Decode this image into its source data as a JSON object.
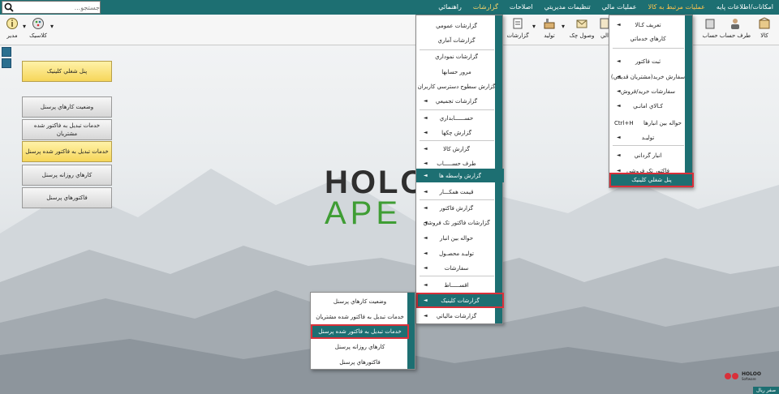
{
  "menubar": {
    "items": [
      "امکانات/اطلاعات پايه",
      "عمليات مرتبط به کالا",
      "عمليات مالي",
      "تنظيمات مديريتي",
      "اصلاحات",
      "گزارشات",
      "راهنمائي"
    ],
    "search_placeholder": "جستجو..."
  },
  "toolbar": {
    "right": [
      "کالا",
      "طرف حساب",
      "حساب",
      "الي"
    ],
    "middle": [
      "وصول چک",
      "توليد",
      "گزارشات"
    ],
    "left": [
      "مدير",
      "کلاسيک"
    ]
  },
  "left_panel": {
    "top_button": "پنل شغلي کلينيک",
    "buttons": [
      "وضعيت کارهاي پرسنل",
      "خدمات تبديل به فاکتور شده مشتريان",
      "خدمات تبديل به فاکتور شده پرسنل",
      "کارهاي روزانه پرسنل",
      "فاکتورهاي پرسنل"
    ]
  },
  "logo": {
    "line1": "HOLO",
    "line2": "APE"
  },
  "kala_menu": {
    "items": [
      "تعريف کـالا",
      "کارهاي خدماتي",
      "ثبت فاکتور",
      "سفارش خريد(مشتريان قديمي)",
      "سفارشات خريد/فروش",
      "کـالاي امانـي",
      "حواله بين انبارها",
      "توليـد",
      "انبار گرداني",
      "فاکتور تک فروشي",
      "پنل شغلي کلينيک"
    ],
    "shortcut": "Ctrl+H"
  },
  "reports_menu": {
    "items": [
      "گزارشات عمومي",
      "گزارشات آماري",
      "گزارشات نموداري",
      "مرور حسابها",
      "گزارش سطوح دسترسي کاربران",
      "گزارشات تجميعي",
      "حســــــابداري",
      "گزارش چکها",
      "گزارش کالا",
      "طرف حســـــاب",
      "گزارش واسطه ها",
      "قيمت همکـــار",
      "گزارش فاکتور",
      "گزارشات فاکتور تک فروشي",
      "حواله بين انبار",
      "توليـد محصـول",
      "سفارشات",
      "اقســـــاط",
      "گزارشات کلينيک",
      "گزارشات مالياتي"
    ]
  },
  "clinic_menu": {
    "items": [
      "وضعيت کارهاي پرسنل",
      "خدمات تبديل به فاکتور شده مشتريان",
      "خدمات تبديل به فاکتور شده پرسنل",
      "کارهاي روزانه پرسنل",
      "فاکتورهاي پرسنل"
    ]
  },
  "badge": {
    "brand": "HOLOO",
    "sub": "Software"
  },
  "status": {
    "label": "صفر ريال"
  },
  "colors": {
    "teal": "#1d6f72",
    "highlight_box": "#d9303a",
    "yellow_button": "#f6d65a",
    "logo_green": "#3f9d34"
  }
}
